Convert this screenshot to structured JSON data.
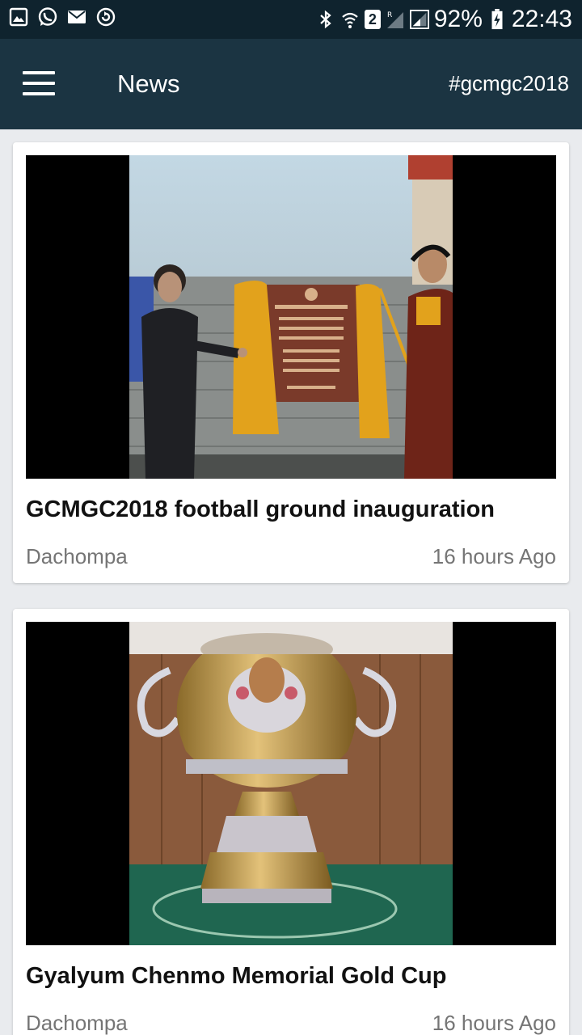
{
  "status_bar": {
    "battery": "92%",
    "time": "22:43",
    "sim_slot": "2",
    "left_icons": [
      "gallery-icon",
      "whatsapp-icon",
      "mail-icon",
      "sync-icon"
    ],
    "right_icons": [
      "bluetooth-icon",
      "wifi-icon",
      "roaming-signal-icon",
      "signal-icon",
      "battery-charging-icon"
    ]
  },
  "app_bar": {
    "title": "News",
    "hashtag": "#gcmgc2018",
    "menu_icon": "hamburger-menu-icon",
    "background": "#1b3442"
  },
  "news": [
    {
      "title": "GCMGC2018 football ground inauguration",
      "author": "Dachompa",
      "time": "16 hours Ago",
      "image": "photo of plaque unveiling with yellow curtains"
    },
    {
      "title": "Gyalyum Chenmo Memorial Gold Cup",
      "author": "Dachompa",
      "time": "16 hours Ago",
      "image": "photo of gold and silver trophy cup"
    }
  ]
}
